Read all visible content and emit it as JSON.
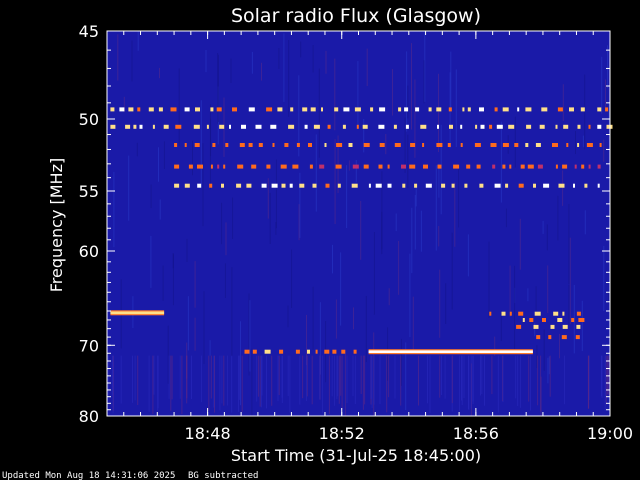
{
  "chart_data": {
    "type": "heatmap",
    "title": "Solar radio Flux (Glasgow)",
    "xlabel": "Start Time (31-Jul-25 18:45:00)",
    "ylabel": "Frequency [MHz]",
    "x_range_minutes": [
      0,
      15
    ],
    "x_ticks": [
      {
        "label": "18:48",
        "minute": 3
      },
      {
        "label": "18:52",
        "minute": 7
      },
      {
        "label": "18:56",
        "minute": 11
      },
      {
        "label": "19:00",
        "minute": 15
      }
    ],
    "y_range_mhz": [
      45,
      80
    ],
    "y_ticks": [
      45,
      50,
      55,
      60,
      70,
      80
    ],
    "background_color": "#1a1aa8",
    "colorscale": [
      "#1a1aa8",
      "#c0306a",
      "#ff6a1e",
      "#ffe08a",
      "#ffffff"
    ],
    "features": [
      {
        "desc": "periodic interference band",
        "freq_mhz": 49.4,
        "t_start": 0.1,
        "t_end": 14.9,
        "intensity": 0.95,
        "dashed": true
      },
      {
        "desc": "periodic interference band",
        "freq_mhz": 50.5,
        "t_start": 0.1,
        "t_end": 14.9,
        "intensity": 1.0,
        "dashed": true
      },
      {
        "desc": "periodic interference band",
        "freq_mhz": 51.7,
        "t_start": 2.0,
        "t_end": 14.9,
        "intensity": 0.7,
        "dashed": true
      },
      {
        "desc": "periodic interference band",
        "freq_mhz": 53.2,
        "t_start": 2.0,
        "t_end": 14.9,
        "intensity": 0.6,
        "dashed": true
      },
      {
        "desc": "periodic interference band",
        "freq_mhz": 54.6,
        "t_start": 2.0,
        "t_end": 14.9,
        "intensity": 1.0,
        "dashed": true
      },
      {
        "desc": "emission patch",
        "freq_mhz": 66.2,
        "t_start": 0.1,
        "t_end": 1.7,
        "intensity": 0.75,
        "dashed": false
      },
      {
        "desc": "continuous emission line",
        "freq_mhz": 70.8,
        "t_start": 7.8,
        "t_end": 12.7,
        "intensity": 1.0,
        "dashed": false
      },
      {
        "desc": "sparse dots",
        "freq_mhz": 70.8,
        "t_start": 4.1,
        "t_end": 7.5,
        "intensity": 0.7,
        "dashed": true
      },
      {
        "desc": "emission cluster",
        "freq_mhz": 66.3,
        "t_start": 11.4,
        "t_end": 14.1,
        "intensity": 0.8,
        "dashed": true
      },
      {
        "desc": "emission cluster",
        "freq_mhz": 67.0,
        "t_start": 12.4,
        "t_end": 14.1,
        "intensity": 0.85,
        "dashed": true
      },
      {
        "desc": "emission cluster",
        "freq_mhz": 67.8,
        "t_start": 12.2,
        "t_end": 14.1,
        "intensity": 0.8,
        "dashed": true
      },
      {
        "desc": "emission cluster",
        "freq_mhz": 69.0,
        "t_start": 12.8,
        "t_end": 14.1,
        "intensity": 0.6,
        "dashed": true
      }
    ]
  },
  "footer": {
    "updated": "Updated Mon Aug 18 14:31:06 2025",
    "note": "BG subtracted"
  }
}
